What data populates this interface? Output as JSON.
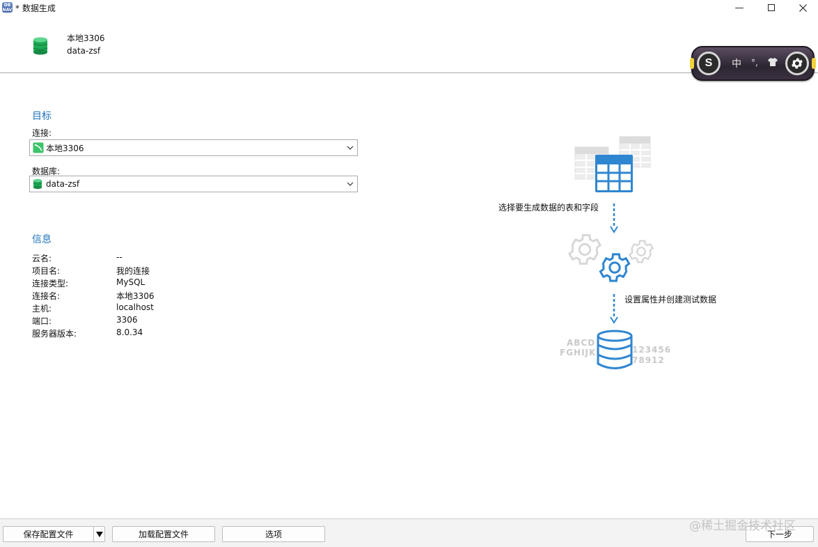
{
  "window": {
    "app_icon_text": "DB\nNAV",
    "title": "* 数据生成",
    "minimize": "—"
  },
  "header": {
    "connection": "本地3306",
    "database": "data-zsf"
  },
  "ime": {
    "logo": "S",
    "lang": "中",
    "punct": "°,"
  },
  "target": {
    "title": "目标",
    "connection_label": "连接:",
    "connection_value": "本地3306",
    "database_label": "数据库:",
    "database_value": "data-zsf"
  },
  "info": {
    "title": "信息",
    "rows": [
      {
        "key": "云名:",
        "value": "--"
      },
      {
        "key": "项目名:",
        "value": "我的连接"
      },
      {
        "key": "连接类型:",
        "value": "MySQL"
      },
      {
        "key": "连接名:",
        "value": "本地3306"
      },
      {
        "key": "主机:",
        "value": "localhost"
      },
      {
        "key": "端口:",
        "value": "3306"
      },
      {
        "key": "服务器版本:",
        "value": "8.0.34"
      }
    ]
  },
  "illustration": {
    "step1": "选择要生成数据的表和字段",
    "step2": "设置属性并创建测试数据",
    "faded_left_1": "ABCD",
    "faded_left_2": "FGHIJKL",
    "faded_right_1": "123456",
    "faded_right_2": "78912"
  },
  "footer": {
    "save_config": "保存配置文件",
    "load_config": "加载配置文件",
    "options": "选项",
    "next": "下一步",
    "watermark": "@稀土掘金技术社区"
  },
  "colors": {
    "accent": "#1e73be",
    "db_green": "#1faa55",
    "illus_blue": "#2f86d0"
  }
}
